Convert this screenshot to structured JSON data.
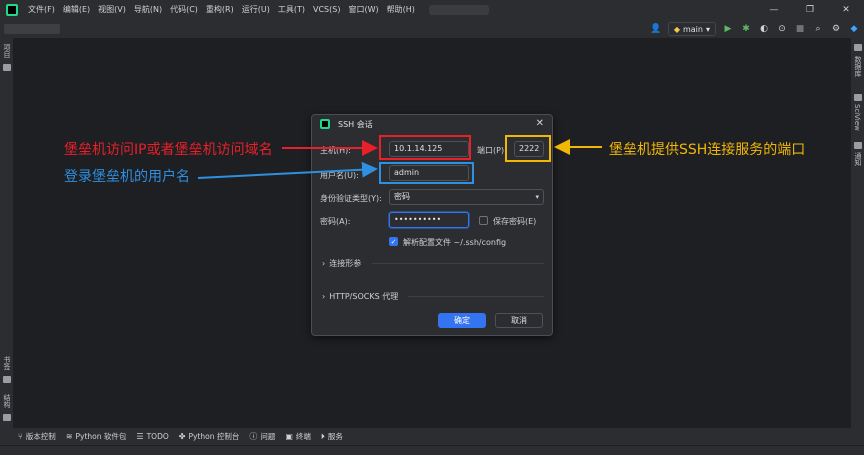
{
  "menu": [
    "文件(F)",
    "编辑(E)",
    "视图(V)",
    "导航(N)",
    "代码(C)",
    "重构(R)",
    "运行(U)",
    "工具(T)",
    "VCS(S)",
    "窗口(W)",
    "帮助(H)"
  ],
  "toolbar": {
    "branch": "main"
  },
  "left_strip": {
    "top_label": "项目",
    "bottom_label_1": "书签",
    "bottom_label_2": "结构"
  },
  "right_strip": {
    "label_1": "数据库",
    "label_2": "SciView",
    "label_3": "通知"
  },
  "bottom_tools": [
    {
      "icon": "branch-icon",
      "label": "版本控制"
    },
    {
      "icon": "layers-icon",
      "label": "Python 软件包"
    },
    {
      "icon": "list-icon",
      "label": "TODO"
    },
    {
      "icon": "python-icon",
      "label": "Python 控制台"
    },
    {
      "icon": "warning-icon",
      "label": "问题"
    },
    {
      "icon": "terminal-icon",
      "label": "终端"
    },
    {
      "icon": "play-icon",
      "label": "服务"
    }
  ],
  "dialog": {
    "title": "SSH 会话",
    "host_label": "主机(H):",
    "host_value": "10.1.14.125",
    "port_label": "端口(P):",
    "port_value": "2222",
    "user_label": "用户名(U):",
    "user_value": "admin",
    "auth_label": "身份验证类型(Y):",
    "auth_value": "密码",
    "password_label": "密码(A):",
    "password_value": "••••••••••",
    "save_password_label": "保存密码(E)",
    "save_password_checked": false,
    "parse_config_label": "解析配置文件 ~/.ssh/config",
    "parse_config_checked": true,
    "section_connection": "连接形参",
    "section_proxy": "HTTP/SOCKS 代理",
    "ok_label": "确定",
    "cancel_label": "取消"
  },
  "annotations": {
    "host_note": "堡垒机访问IP或者堡垒机访问域名",
    "user_note": "登录堡垒机的用户名",
    "port_note": "堡垒机提供SSH连接服务的端口",
    "colors": {
      "red": "#e8202a",
      "blue": "#2f8fe0",
      "yellow": "#f2b705"
    }
  }
}
